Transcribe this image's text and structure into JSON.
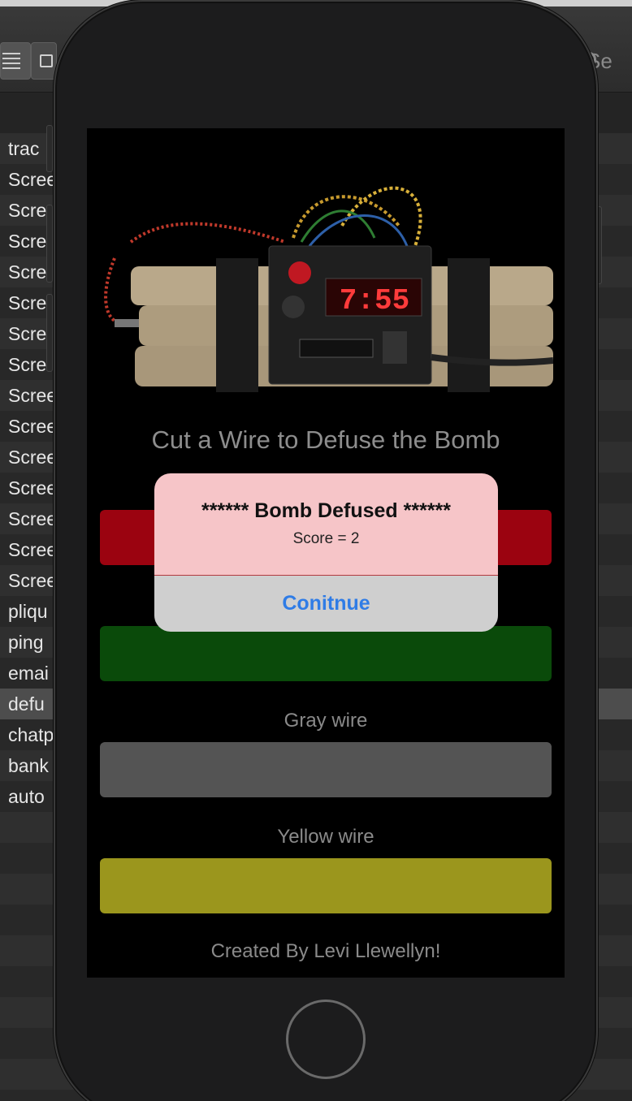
{
  "finder": {
    "search_label": "Se",
    "rows": [
      "trac",
      "Scree",
      "Scre",
      "Scre",
      "Scre",
      "Scre",
      "Scre",
      "Scre",
      "Scree",
      "Scree",
      "Scree",
      "Scree",
      "Scree",
      "Scree",
      "Scree",
      "pliqu",
      "ping",
      "emai",
      "defu",
      "chatp",
      "bank",
      "auto"
    ],
    "selected_index": 18
  },
  "app": {
    "bomb_display": "7:55",
    "title": "Cut a Wire to Defuse the Bomb",
    "wires": [
      {
        "label": "",
        "color": "#9b0310"
      },
      {
        "label": "",
        "color": "#0a4a0a"
      },
      {
        "label": "Gray wire",
        "color": "#545454"
      },
      {
        "label": "Yellow wire",
        "color": "#9b961d"
      }
    ],
    "credit": "Created By Levi Llewellyn!"
  },
  "alert": {
    "title": "****** Bomb Defused ******",
    "message": "Score = 2",
    "button_label": "Conitnue"
  }
}
